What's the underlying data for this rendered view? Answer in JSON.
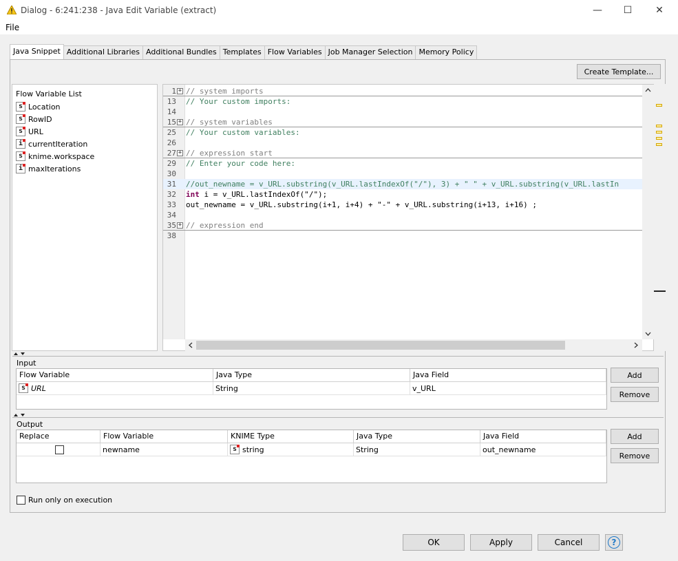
{
  "window": {
    "title": "Dialog - 6:241:238 - Java Edit Variable (extract)",
    "minimize_glyph": "—",
    "maximize_glyph": "☐",
    "close_glyph": "✕"
  },
  "menu": {
    "file": "File"
  },
  "tabs": [
    {
      "label": "Java Snippet",
      "active": true
    },
    {
      "label": "Additional Libraries"
    },
    {
      "label": "Additional Bundles"
    },
    {
      "label": "Templates"
    },
    {
      "label": "Flow Variables"
    },
    {
      "label": "Job Manager Selection"
    },
    {
      "label": "Memory Policy"
    }
  ],
  "create_template_label": "Create Template...",
  "flow_variable_list": {
    "header": "Flow Variable List",
    "items": [
      {
        "type": "s",
        "name": "Location"
      },
      {
        "type": "s",
        "name": "RowID"
      },
      {
        "type": "s",
        "name": "URL"
      },
      {
        "type": "i",
        "name": "currentIteration"
      },
      {
        "type": "s",
        "name": "knime.workspace"
      },
      {
        "type": "i",
        "name": "maxIterations"
      }
    ]
  },
  "editor": {
    "lines": [
      {
        "num": "1",
        "fold": "+",
        "text": "// system imports",
        "style": "comment-grey",
        "sep": true
      },
      {
        "num": "13",
        "text": "// Your custom imports:",
        "style": "comment-green"
      },
      {
        "num": "14",
        "text": ""
      },
      {
        "num": "15",
        "fold": "+",
        "text": "// system variables",
        "style": "comment-grey",
        "sep": true
      },
      {
        "num": "25",
        "text": "// Your custom variables:",
        "style": "comment-green"
      },
      {
        "num": "26",
        "text": ""
      },
      {
        "num": "27",
        "fold": "+",
        "text": "// expression start",
        "style": "comment-grey",
        "sep": true
      },
      {
        "num": "29",
        "text": "// Enter your code here:",
        "style": "comment-green"
      },
      {
        "num": "30",
        "text": ""
      },
      {
        "num": "31",
        "text": "//out_newname = v_URL.substring(v_URL.lastIndexOf(\"/\"), 3) + \" \" + v_URL.substring(v_URL.lastIn",
        "style": "comment-green",
        "highlight": true
      },
      {
        "num": "32",
        "kw": "int",
        "text": " i = v_URL.lastIndexOf(\"/\");"
      },
      {
        "num": "33",
        "text": "out_newname = v_URL.substring(i+1, i+4) + \"-\" + v_URL.substring(i+13, i+16) ;"
      },
      {
        "num": "34",
        "text": ""
      },
      {
        "num": "35",
        "fold": "+",
        "text": "// expression end",
        "style": "comment-grey",
        "sep": true
      },
      {
        "num": "38",
        "text": ""
      }
    ]
  },
  "input": {
    "label": "Input",
    "columns": [
      "Flow Variable",
      "Java Type",
      "Java Field"
    ],
    "rows": [
      {
        "type": "s",
        "flow_variable": "URL",
        "java_type": "String",
        "java_field": "v_URL"
      }
    ],
    "add_label": "Add",
    "remove_label": "Remove"
  },
  "output": {
    "label": "Output",
    "columns": [
      "Replace",
      "Flow Variable",
      "KNIME Type",
      "Java Type",
      "Java Field"
    ],
    "rows": [
      {
        "replace": false,
        "flow_variable": "newname",
        "knime_type_icon": "s",
        "knime_type": "string",
        "java_type": "String",
        "java_field": "out_newname"
      }
    ],
    "add_label": "Add",
    "remove_label": "Remove"
  },
  "run_only_on_execution_label": "Run only on execution",
  "footer": {
    "ok": "OK",
    "apply": "Apply",
    "cancel": "Cancel",
    "help_glyph": "?"
  },
  "colors": {
    "accent_help": "#1e78c8",
    "comment_green": "#3f7f5f",
    "keyword": "#7f0055"
  }
}
